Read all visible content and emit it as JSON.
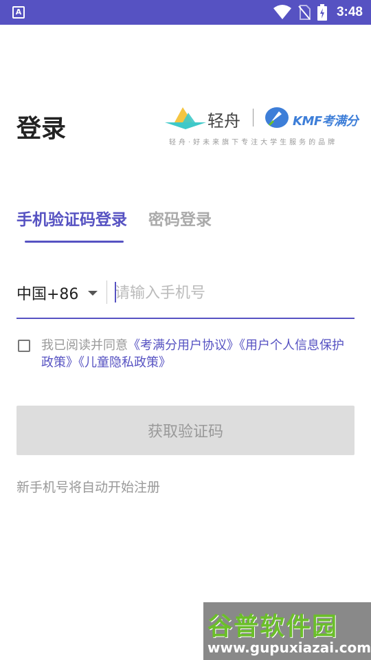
{
  "status_bar": {
    "app_icon_letter": "A",
    "time": "3:48"
  },
  "header": {
    "title": "登录",
    "brand": {
      "qingzhou": "轻舟",
      "kmf_latin": "KMF",
      "kmf_cn": "考满分",
      "slogan": "轻舟·好未来旗下专注大学生服务的品牌"
    }
  },
  "tabs": [
    {
      "label": "手机验证码登录",
      "active": true
    },
    {
      "label": "密码登录",
      "active": false
    }
  ],
  "phone": {
    "country_code": "中国+86",
    "placeholder": "请输入手机号",
    "value": ""
  },
  "agreement": {
    "checked": false,
    "prefix": "我已阅读并同意",
    "links": [
      "《考满分用户协议》",
      "《用户个人信息保护政策》",
      "《儿童隐私政策》"
    ]
  },
  "button": {
    "label": "获取验证码"
  },
  "note": "新手机号将自动开始注册",
  "watermark": {
    "cn": "谷普软件园",
    "url": "www.gupuxiazai.com"
  },
  "colors": {
    "accent": "#5652c2",
    "status_bar": "#5652c2",
    "disabled_button": "#dddddd",
    "kmf_blue": "#3d7ed8"
  }
}
